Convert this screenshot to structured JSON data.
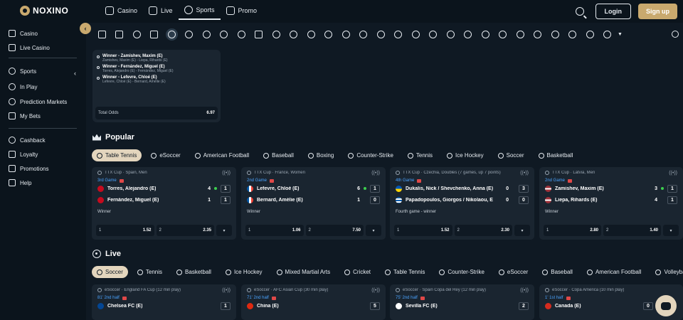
{
  "brand": {
    "name": "NOXINO"
  },
  "topnav": [
    {
      "label": "Casino",
      "icon": "casino-icon"
    },
    {
      "label": "Live",
      "icon": "live-casino-icon"
    },
    {
      "label": "Sports",
      "icon": "sports-icon",
      "active": true
    },
    {
      "label": "Promo",
      "icon": "gift-icon"
    }
  ],
  "auth": {
    "login_label": "Login",
    "signup_label": "Sign up"
  },
  "sidebar": {
    "items": [
      {
        "label": "Casino",
        "icon": "casino-icon"
      },
      {
        "label": "Live Casino",
        "icon": "live-casino-icon"
      },
      {
        "label": "Sports",
        "icon": "soccer-ball-icon"
      },
      {
        "label": "In Play",
        "icon": "play-icon"
      },
      {
        "label": "Prediction Markets",
        "icon": "prediction-icon"
      },
      {
        "label": "My Bets",
        "icon": "my-bets-icon"
      },
      {
        "label": "Cashback",
        "icon": "cashback-icon"
      },
      {
        "label": "Loyalty",
        "icon": "crown-icon"
      },
      {
        "label": "Promotions",
        "icon": "gift-icon"
      },
      {
        "label": "Help",
        "icon": "help-icon"
      }
    ]
  },
  "betslip": {
    "selections": [
      {
        "title": "Winner - Zamishev, Maxim (E)",
        "subtitle": "Zamishev, Maxim (E) - Liepa, Rihards (E)"
      },
      {
        "title": "Winner - Fernández, Miguel (E)",
        "subtitle": "Torres, Alejandro (E) - Fernández, Miguel (E)"
      },
      {
        "title": "Winner - Lefevre, Chloé (E)",
        "subtitle": "Lefevre, Chloé (E) - Bernard, Amélie (E)"
      }
    ],
    "total_label": "Total Odds",
    "total_value": "6.97"
  },
  "popular": {
    "title": "Popular",
    "chips": [
      "Table Tennis",
      "eSoccer",
      "American Football",
      "Baseball",
      "Boxing",
      "Counter-Strike",
      "Tennis",
      "Ice Hockey",
      "Soccer",
      "Basketball"
    ],
    "matches": [
      {
        "competition": "TTX Cup · Spain, Men",
        "status": "3rd Game",
        "team1": {
          "name": "Torres, Alejandro (E)",
          "score": "4",
          "sets": "1",
          "serve": true,
          "flag": "#c60b1e"
        },
        "team2": {
          "name": "Fernández, Miguel (E)",
          "score": "1",
          "sets": "1",
          "serve": false,
          "flag": "#c60b1e"
        },
        "market": "Winner",
        "odds": [
          {
            "label": "1",
            "value": "1.52"
          },
          {
            "label": "2",
            "value": "2.35"
          }
        ]
      },
      {
        "competition": "TTX Cup · France, Women",
        "status": "2nd Game",
        "team1": {
          "name": "Lefevre, Chloé (E)",
          "score": "6",
          "sets": "1",
          "serve": true,
          "flag": "#0055a4"
        },
        "team2": {
          "name": "Bernard, Amélie (E)",
          "score": "1",
          "sets": "0",
          "serve": false,
          "flag": "#0055a4"
        },
        "market": "Winner",
        "odds": [
          {
            "label": "1",
            "value": "1.06"
          },
          {
            "label": "2",
            "value": "7.50"
          }
        ]
      },
      {
        "competition": "TTX Cup · Czechia, Doubles (7 games, up 7 points)",
        "status": "4th Game",
        "team1": {
          "name": "Dukalis, Nick / Shevchenko, Anna (E)",
          "score": "0",
          "sets": "3",
          "serve": false,
          "flag": "#ffd500"
        },
        "team2": {
          "name": "Papadopoulos, Giorgos / Nikolaou, E",
          "score": "0",
          "sets": "0",
          "serve": false,
          "flag": "#0d5eaf"
        },
        "market": "Fourth game - winner",
        "odds": [
          {
            "label": "1",
            "value": "1.52"
          },
          {
            "label": "2",
            "value": "2.30"
          }
        ]
      },
      {
        "competition": "TTX Cup · Latvia, Men",
        "status": "2nd Game",
        "team1": {
          "name": "Zamishev, Maxim (E)",
          "score": "3",
          "sets": "1",
          "serve": true,
          "flag": "#9e3039"
        },
        "team2": {
          "name": "Liepa, Rihards (E)",
          "score": "4",
          "sets": "1",
          "serve": false,
          "flag": "#9e3039"
        },
        "market": "Winner",
        "odds": [
          {
            "label": "1",
            "value": "2.80"
          },
          {
            "label": "2",
            "value": "1.40"
          }
        ]
      }
    ]
  },
  "live": {
    "title": "Live",
    "chips": [
      "Soccer",
      "Tennis",
      "Basketball",
      "Ice Hockey",
      "Mixed Martial Arts",
      "Cricket",
      "Table Tennis",
      "Counter-Strike",
      "eSoccer",
      "Baseball",
      "American Football",
      "Volleyball"
    ],
    "matches": [
      {
        "competition": "eSoccer · England FA Cup (12 min play)",
        "status": "81' 2nd half",
        "team1": {
          "name": "Chelsea FC (E)",
          "sets": "1"
        }
      },
      {
        "competition": "eSoccer · AFC Asian Cup (30 min play)",
        "status": "71' 2nd half",
        "team1": {
          "name": "China (E)",
          "sets": "5"
        }
      },
      {
        "competition": "eSoccer · Spain Copa del Rey (12 min play)",
        "status": "75' 2nd half",
        "team1": {
          "name": "Sevilla FC (E)",
          "sets": "2"
        }
      },
      {
        "competition": "eSoccer · Copa America (10 min play)",
        "status": "1' 1st half",
        "team1": {
          "name": "Canada (E)",
          "sets": "0"
        }
      }
    ]
  },
  "colors": {
    "accent": "#c9a96e",
    "background": "#0f1923",
    "card": "#1a2530",
    "live_status": "#4aa3ff"
  }
}
